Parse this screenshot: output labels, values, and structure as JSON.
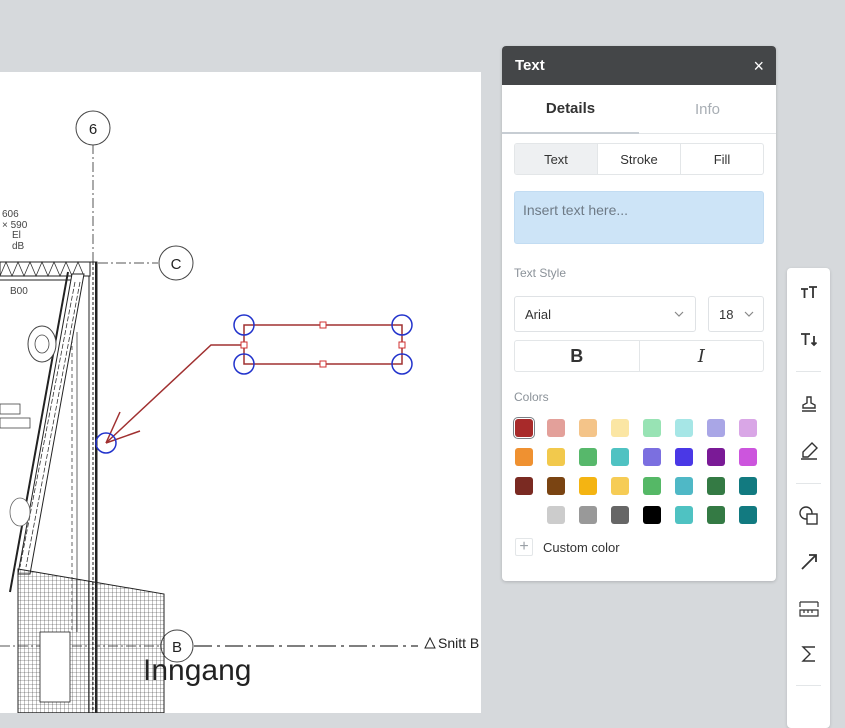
{
  "drawing": {
    "grid_label_6": "6",
    "grid_label_c": "C",
    "grid_label_b": "B",
    "dim_text": [
      "606",
      "×  590",
      "El",
      "dB"
    ],
    "room_code": "B00",
    "section_label": "Snitt B",
    "entrance_label": "Inngang"
  },
  "panel": {
    "title": "Text",
    "close_icon": "×",
    "tabs": [
      "Details",
      "Info"
    ],
    "subtabs": [
      "Text",
      "Stroke",
      "Fill"
    ],
    "text_placeholder": "Insert text here...",
    "text_style_label": "Text Style",
    "font": "Arial",
    "size": "18",
    "bold_label": "B",
    "italic_label": "I",
    "colors_label": "Colors",
    "swatches": [
      "#a82a2a",
      "#e3a09a",
      "#f4c489",
      "#fbe6a4",
      "#98e3b4",
      "#a6e6e6",
      "#a9a6e6",
      "#d9a6e6",
      "#ef9131",
      "#f2c94c",
      "#57b86b",
      "#4fc2c2",
      "#7b6fe0",
      "#4a38e6",
      "#7a1a96",
      "#cc55dd",
      "#7a2a22",
      "#7a4412",
      "#f4b412",
      "#f6cc55",
      "#55b866",
      "#4fb8c6",
      "#347a44",
      "#127a80",
      "",
      "#cccccc",
      "#999999",
      "#666666",
      "#000000",
      "#4fc2c2",
      "#347a44",
      "#127a80"
    ],
    "selected_swatch": 0,
    "custom_color_label": "Custom color"
  },
  "toolbar": {
    "icons": [
      "text-size-icon",
      "text-direction-icon",
      "stamp-icon",
      "highlighter-icon",
      "shapes-icon",
      "arrow-icon",
      "measure-icon",
      "sigma-icon"
    ]
  }
}
